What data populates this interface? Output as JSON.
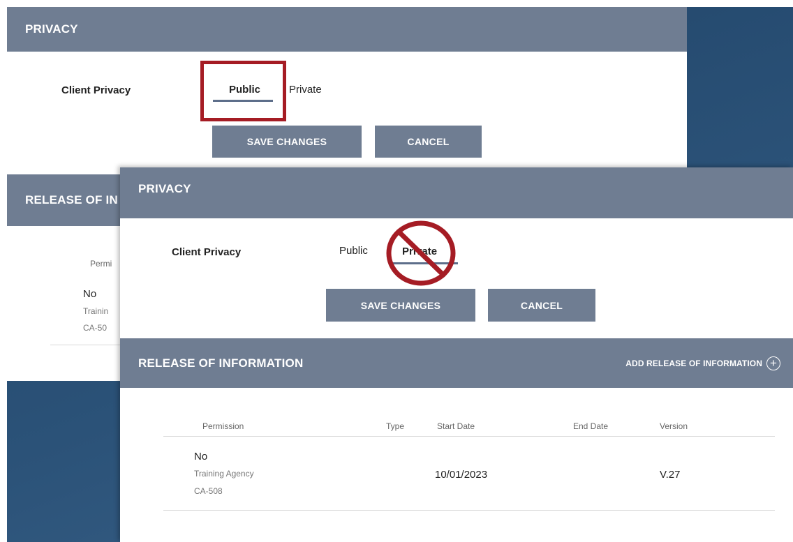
{
  "back_panel": {
    "privacy_header": "PRIVACY",
    "client_privacy_label": "Client Privacy",
    "tabs": [
      {
        "label": "Public"
      },
      {
        "label": "Private"
      }
    ],
    "save_label": "SAVE CHANGES",
    "cancel_label": "CANCEL",
    "release_header_partial": "RELEASE OF IN",
    "partial_col": "Permi",
    "partial_row": {
      "permission": "No",
      "agency": "Trainin",
      "code": "CA-50"
    }
  },
  "front_panel": {
    "privacy_header": "PRIVACY",
    "client_privacy_label": "Client Privacy",
    "tabs": [
      {
        "label": "Public"
      },
      {
        "label": "Private"
      }
    ],
    "save_label": "SAVE CHANGES",
    "cancel_label": "CANCEL",
    "release_header": "RELEASE OF INFORMATION",
    "add_release_label": "ADD RELEASE OF INFORMATION",
    "add_icon": "plus-circle-icon",
    "columns": [
      "Permission",
      "Type",
      "Start Date",
      "End Date",
      "Version"
    ],
    "rows": [
      {
        "permission": "No",
        "agency": "Training Agency",
        "code": "CA-508",
        "type": "",
        "start_date": "10/01/2023",
        "end_date": "",
        "version": "V.27"
      }
    ]
  },
  "annotations": {
    "highlight_color": "#a51c24",
    "prohibited_icon": "no-entry-icon"
  },
  "colors": {
    "header_bg": "#6f7d92",
    "background_blue": "#2b5278",
    "tab_underline": "#5d6e8a"
  }
}
